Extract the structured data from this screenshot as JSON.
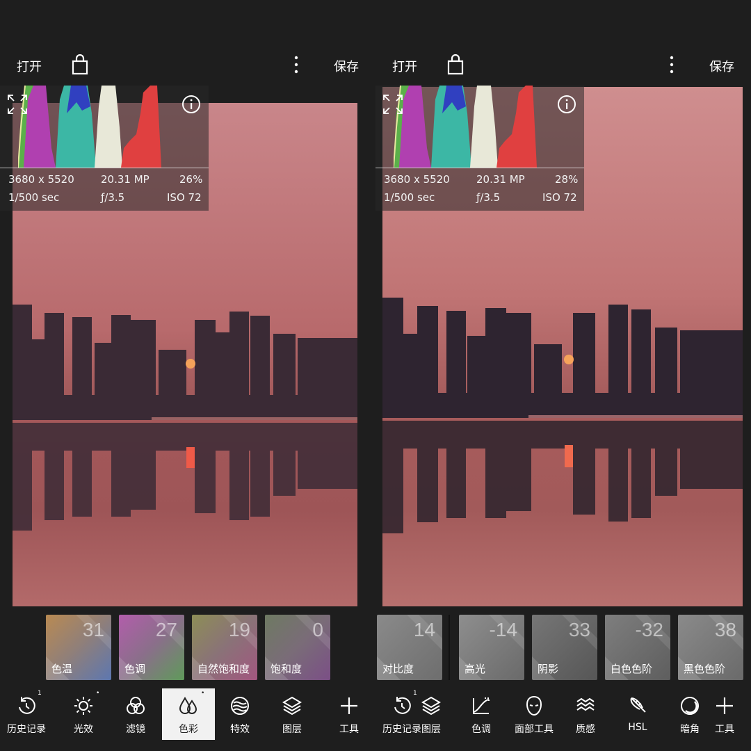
{
  "left": {
    "topbar": {
      "open_label": "打开",
      "save_label": "保存"
    },
    "info": {
      "resolution": "3680 x 5520",
      "megapixels": "20.31 MP",
      "zoom": "26%",
      "shutter": "1/500 sec",
      "aperture": "ƒ/3.5",
      "iso": "ISO 72"
    },
    "tiles": [
      {
        "value": "31",
        "label": "色温"
      },
      {
        "value": "27",
        "label": "色调"
      },
      {
        "value": "19",
        "label": "自然饱和度"
      },
      {
        "value": "0",
        "label": "饱和度"
      }
    ],
    "tools": [
      {
        "label": "历史记录",
        "icon": "history-icon",
        "sup": "1"
      },
      {
        "label": "光效",
        "icon": "sun-icon",
        "sup": "•"
      },
      {
        "label": "滤镜",
        "icon": "filter-circles-icon"
      },
      {
        "label": "色彩",
        "icon": "color-drops-icon",
        "sup": "•",
        "active": true
      },
      {
        "label": "特效",
        "icon": "waves-circle-icon"
      },
      {
        "label": "图层",
        "icon": "layers-icon"
      },
      {
        "label": "工具",
        "icon": "plus-icon"
      }
    ]
  },
  "right": {
    "topbar": {
      "open_label": "打开",
      "save_label": "保存"
    },
    "info": {
      "resolution": "3680 x 5520",
      "megapixels": "20.31 MP",
      "zoom": "28%",
      "shutter": "1/500 sec",
      "aperture": "ƒ/3.5",
      "iso": "ISO 72"
    },
    "tiles": [
      {
        "value": "14",
        "label": "对比度"
      },
      {
        "value": "-14",
        "label": "高光"
      },
      {
        "value": "33",
        "label": "阴影"
      },
      {
        "value": "-32",
        "label": "白色色阶"
      },
      {
        "value": "38",
        "label": "黑色色阶"
      }
    ],
    "tools": [
      {
        "label": "历史记录",
        "icon": "history-icon",
        "sup": "1"
      },
      {
        "label": "图层",
        "icon": "layers-icon"
      },
      {
        "label": "色调",
        "icon": "curves-icon"
      },
      {
        "label": "面部工具",
        "icon": "face-icon"
      },
      {
        "label": "质感",
        "icon": "texture-waves-icon"
      },
      {
        "label": "HSL",
        "icon": "feather-icon"
      },
      {
        "label": "暗角",
        "icon": "vignette-icon"
      },
      {
        "label": "工具",
        "icon": "plus-icon"
      }
    ]
  }
}
